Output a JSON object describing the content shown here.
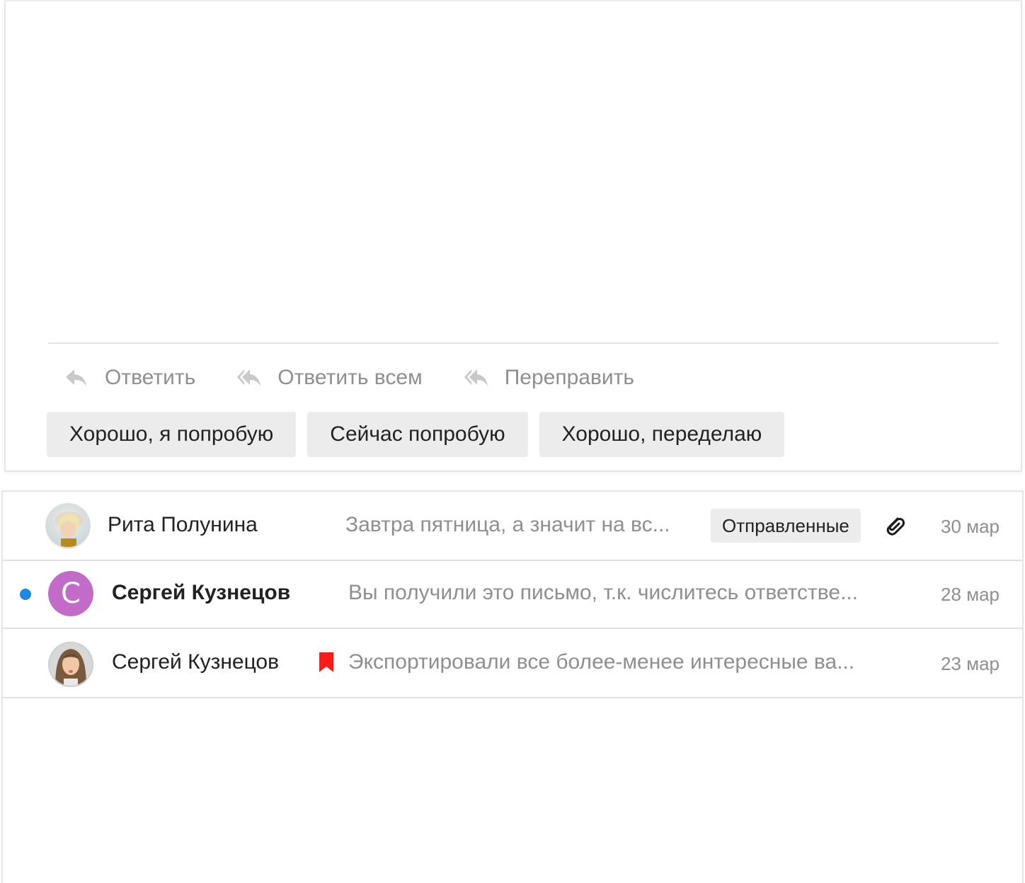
{
  "message_actions": {
    "reply": {
      "label": "Ответить",
      "icon": "reply-icon"
    },
    "reply_all": {
      "label": "Ответить всем",
      "icon": "reply-all-icon"
    },
    "forward": {
      "label": "Переправить",
      "icon": "forward-icon"
    }
  },
  "quick_replies": [
    "Хорошо, я попробую",
    "Сейчас попробую",
    "Хорошо, переделаю"
  ],
  "mail_list": [
    {
      "sender": "Рита Полунина",
      "snippet": "Завтра пятница, а значит на вс...",
      "folder": "Отправленные",
      "has_attachment": true,
      "date": "30 мар",
      "unread": false
    },
    {
      "sender": "Сергей Кузнецов",
      "avatar_letter": "С",
      "snippet": "Вы получили это письмо, т.к. числитесь ответстве...",
      "date": "28 мар",
      "unread": true
    },
    {
      "sender": "Сергей Кузнецов",
      "snippet": "Экспортировали все более-менее интересные ва...",
      "flagged": true,
      "date": "23 мар",
      "unread": false
    }
  ],
  "colors": {
    "unread_dot": "#1e88e5",
    "avatar_letter_bg": "#c26bc9",
    "bookmark_flag": "#ff1a1a",
    "chip_bg": "#ececec",
    "muted_text": "#8f8f8f"
  }
}
